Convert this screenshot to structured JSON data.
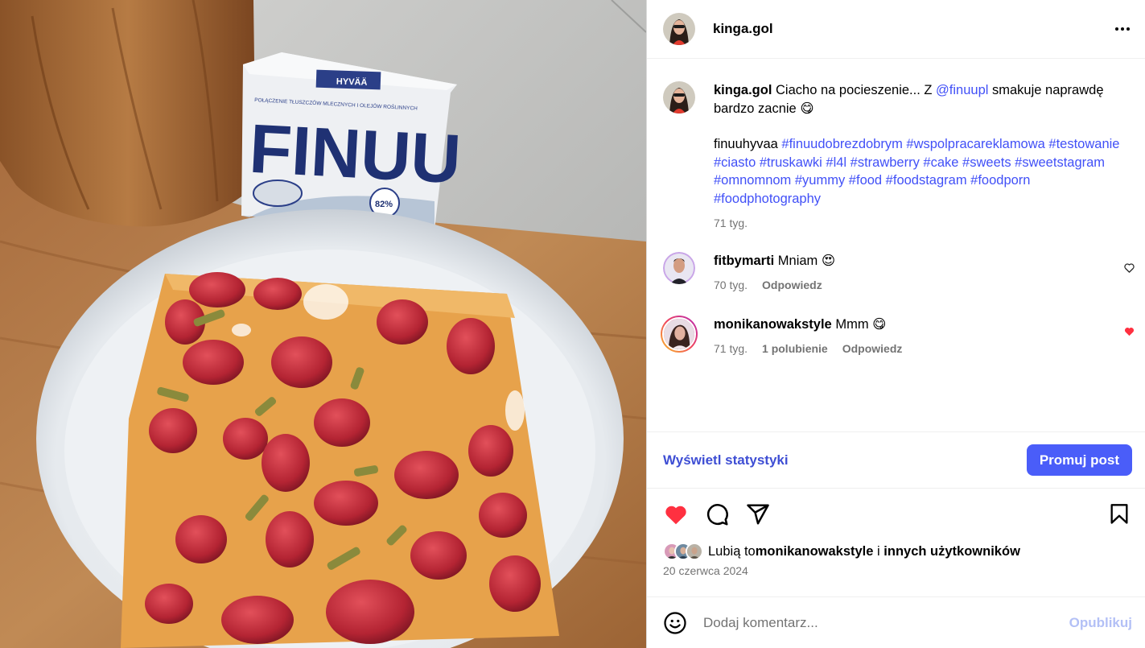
{
  "post": {
    "author": "kinga.gol",
    "photo_product_brand": "FINUU",
    "photo_product_label": "HYVÄÄ",
    "photo_product_subtitle": "POŁĄCZENIE TŁUSZCZÓW MLECZNYCH I OLEJÓW ROŚLINNYCH",
    "photo_product_badge": "82%",
    "more_icon": "more-horizontal-icon"
  },
  "caption": {
    "author": "kinga.gol",
    "text_before": "Ciacho na pocieszenie... Z ",
    "mention": "@finuupl",
    "text_after": " smakuje naprawdę bardzo zacnie 😋",
    "plain_tag": "finuuhyvaa ",
    "hashtags": "#finuudobrezdobrym #wspolpracareklamowa #testowanie #ciasto #truskawki #l4l #strawberry #cake #sweets #sweetstagram #omnomnom #yummy #food #foodstagram #foodporn #foodphotography",
    "time": "71 tyg."
  },
  "comments": [
    {
      "author": "fitbymarti",
      "text": "Mniam 😍",
      "time": "70 tyg.",
      "reply": "Odpowiedz",
      "liked": false
    },
    {
      "author": "monikanowakstyle",
      "text": "Mmm 😋",
      "time": "71 tyg.",
      "likes": "1 polubienie",
      "reply": "Odpowiedz",
      "liked": true
    }
  ],
  "stats": {
    "view_label": "Wyświetl statystyki",
    "promote_label": "Promuj post"
  },
  "likes": {
    "prefix": "Lubią to ",
    "user": "monikanowakstyle",
    "middle": " i ",
    "others": "innych użytkowników"
  },
  "date": "20 czerwca 2024",
  "add_comment": {
    "placeholder": "Dodaj komentarz...",
    "publish_label": "Opublikuj"
  },
  "colors": {
    "link": "#4150f7",
    "promote_button": "#4a5df9",
    "liked_heart": "#ff3040",
    "publish_disabled": "#b3c0f6"
  }
}
